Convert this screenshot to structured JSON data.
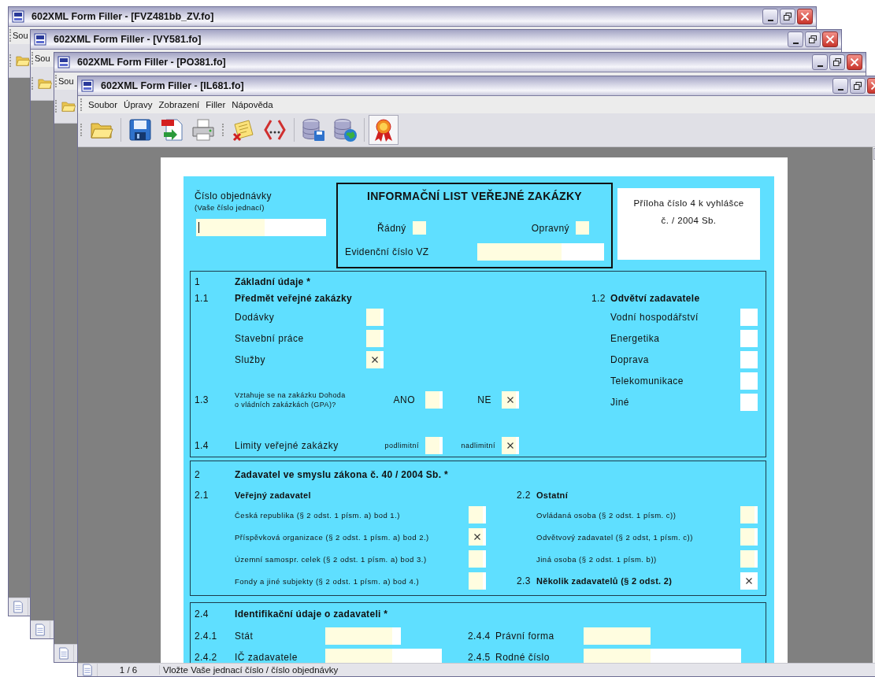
{
  "windows": [
    {
      "kind": "back",
      "title": "602XML Form Filler - [FVZ481bb_ZV.fo]",
      "menu": [
        "Sou"
      ]
    },
    {
      "kind": "back",
      "title": "602XML Form Filler - [VY581.fo]",
      "menu": [
        "Sou"
      ]
    },
    {
      "kind": "back",
      "title": "602XML Form Filler - [PO381.fo]",
      "menu": [
        "Sou"
      ]
    },
    {
      "kind": "front",
      "title": "602XML Form Filler - [IL681.fo]",
      "menu": [
        "Soubor",
        "Úpravy",
        "Zobrazení",
        "Filler",
        "Nápověda"
      ],
      "toolbar": [
        {
          "pressed": false
        },
        {
          "pressed": false
        },
        {
          "pressed": false
        },
        {
          "pressed": false
        },
        {
          "pressed": false
        },
        {
          "pressed": false
        },
        {
          "pressed": false
        },
        {
          "pressed": false
        },
        {
          "pressed": true
        }
      ]
    }
  ],
  "form": {
    "order_number": {
      "label": "Číslo objednávky",
      "hint": "(Vaše číslo jednací)",
      "focused": true
    },
    "title": "INFORMAČNÍ LIST VEŘEJNÉ ZAKÁZKY",
    "type_options": [
      {
        "label": "Řádný",
        "checked": false
      },
      {
        "label": "Opravný",
        "checked": false
      }
    ],
    "registration": {
      "label": "Evidenční číslo VZ"
    },
    "annex": "Příloha číslo 4 k vyhlášce\nč. / 2004 Sb.",
    "section1": {
      "number": "1",
      "title": "Základní údaje *",
      "subject": {
        "number": "1.1",
        "title": "Předmět veřejné zakázky",
        "items": [
          {
            "label": "Dodávky",
            "checked": false
          },
          {
            "label": "Stavební práce",
            "checked": false
          },
          {
            "label": "Služby",
            "checked": true
          }
        ]
      },
      "sector": {
        "number": "1.2",
        "title": "Odvětví zadavatele",
        "items": [
          {
            "label": "Vodní hospodářství",
            "checked": false
          },
          {
            "label": "Energetika",
            "checked": false
          },
          {
            "label": "Doprava",
            "checked": false
          },
          {
            "label": "Telekomunikace",
            "checked": false
          },
          {
            "label": "Jiné",
            "checked": false
          }
        ]
      },
      "gpa": {
        "number": "1.3",
        "question": "Vztahuje se na zakázku Dohoda\no vládních zakázkách (GPA)?",
        "options": [
          {
            "label": "ANO",
            "checked": false
          },
          {
            "label": "NE",
            "checked": true
          }
        ]
      },
      "limits": {
        "number": "1.4",
        "label": "Limity veřejné zakázky",
        "options": [
          {
            "label": "podlimitní",
            "checked": false
          },
          {
            "label": "nadlimitní",
            "checked": true
          }
        ]
      }
    },
    "section2": {
      "number": "2",
      "title": "Zadavatel ve smyslu zákona č. 40 / 2004 Sb. *",
      "public": {
        "number": "2.1",
        "title": "Veřejný zadavatel",
        "items": [
          {
            "label": "Česká republika (§ 2 odst. 1 písm. a) bod 1.)",
            "checked": false
          },
          {
            "label": "Příspěvková organizace (§ 2 odst. 1 písm. a) bod 2.)",
            "checked": true
          },
          {
            "label": "Územní samospr. celek (§ 2 odst. 1 písm. a) bod 3.)",
            "checked": false
          },
          {
            "label": "Fondy a jiné subjekty (§ 2 odst. 1 písm. a) bod 4.)",
            "checked": false
          }
        ]
      },
      "other": {
        "number": "2.2",
        "title": "Ostatní",
        "items": [
          {
            "label": "Ovládaná osoba (§ 2 odst. 1 písm. c))",
            "checked": false
          },
          {
            "label": "Odvětvový zadavatel (§ 2 odst, 1 písm. c))",
            "checked": false
          },
          {
            "label": "Jiná osoba (§ 2 odst. 1 písm. b))",
            "checked": false
          }
        ]
      },
      "multiple": {
        "number": "2.3",
        "label": "Několik zadavatelů (§ 2 odst. 2)",
        "checked": true
      }
    },
    "section3": {
      "number": "2.4",
      "title": "Identifikační údaje o zadavateli *",
      "fields": [
        {
          "number": "2.4.1",
          "label": "Stát"
        },
        {
          "number": "2.4.4",
          "label": "Právní forma"
        },
        {
          "number": "2.4.2",
          "label": "IČ zadavatele"
        },
        {
          "number": "2.4.5",
          "label": "Rodné číslo"
        }
      ]
    }
  },
  "status_bar": {
    "page": "1 / 6",
    "message": "Vložte Vaše jednací číslo / číslo objednávky"
  }
}
